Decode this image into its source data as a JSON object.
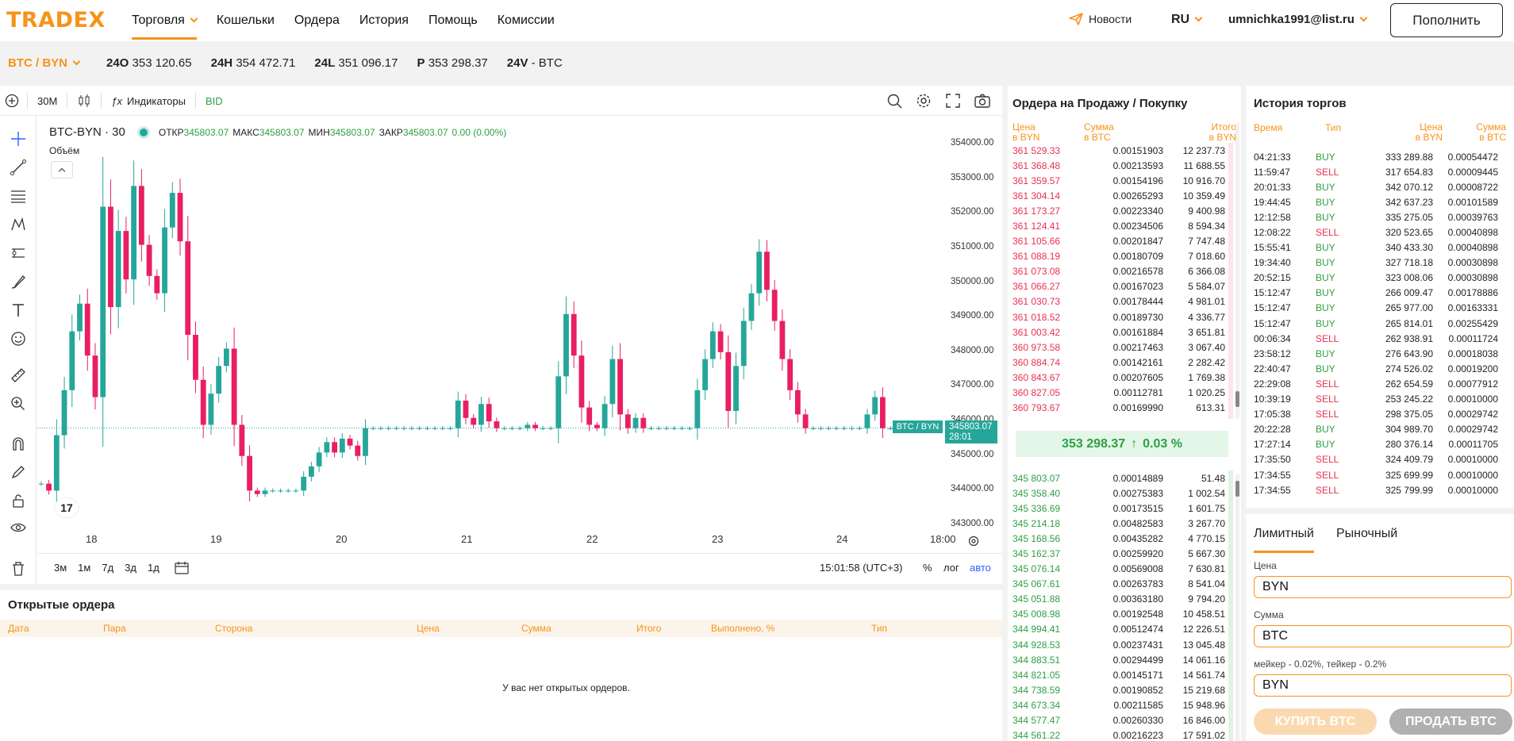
{
  "header": {
    "logo": "TRADEX",
    "nav": [
      {
        "label": "Торговля",
        "active": true
      },
      {
        "label": "Кошельки"
      },
      {
        "label": "Ордера"
      },
      {
        "label": "История"
      },
      {
        "label": "Помощь"
      },
      {
        "label": "Комиссии"
      }
    ],
    "news": "Новости",
    "lang": "RU",
    "user": "umnichka1991@list.ru",
    "deposit": "Пополнить"
  },
  "ticker": {
    "pair": "BTC / BYN",
    "stats": [
      {
        "k": "24O",
        "v": "353 120.65"
      },
      {
        "k": "24H",
        "v": "354 472.71"
      },
      {
        "k": "24L",
        "v": "351 096.17"
      },
      {
        "k": "P",
        "v": "353 298.37"
      },
      {
        "k": "24V",
        "v": "- BTC"
      }
    ]
  },
  "chart": {
    "interval": "30M",
    "indicators": "Индикаторы",
    "bid": "BID",
    "symbol": "BTC-BYN · 30",
    "ohlc": [
      {
        "k": "ОТКР",
        "v": "345803.07"
      },
      {
        "k": "МАКС",
        "v": "345803.07"
      },
      {
        "k": "МИН",
        "v": "345803.07"
      },
      {
        "k": "ЗАКР",
        "v": "345803.07"
      }
    ],
    "change": "0.00 (0.00%)",
    "volume_label": "Объём",
    "price_tag_symbol": "BTC / BYN",
    "price_tag_price": "345803.07",
    "price_tag_time": "28:01",
    "ranges": [
      "3м",
      "1м",
      "7д",
      "3д",
      "1д"
    ],
    "clock": "15:01:58 (UTC+3)",
    "pct": "%",
    "log": "лог",
    "auto": "авто",
    "colors": {
      "up": "#26a69a",
      "down": "#e91e63"
    }
  },
  "chart_data": {
    "type": "candlestick",
    "x_ticks": [
      "18",
      "19",
      "20",
      "21",
      "22",
      "23",
      "24",
      "18:00"
    ],
    "y_ticks": [
      "354000.00",
      "353000.00",
      "352000.00",
      "351000.00",
      "350000.00",
      "349000.00",
      "348000.00",
      "347000.00",
      "346000.00",
      "345000.00",
      "344000.00",
      "343000.00"
    ],
    "ylim": [
      343000,
      354000
    ],
    "last_price": 345803.07,
    "closes": [
      344200,
      344000,
      345600,
      346900,
      348600,
      349400,
      347900,
      346700,
      352200,
      349300,
      351500,
      350100,
      352800,
      351100,
      350200,
      349700,
      351600,
      352600,
      351200,
      348500,
      347200,
      345900,
      346800,
      347600,
      348100,
      345900,
      345000,
      344000,
      343900,
      344000,
      344000,
      344000,
      344000,
      344000,
      344400,
      344700,
      345100,
      345400,
      345100,
      345500,
      345300,
      345000,
      345800,
      345803,
      345803,
      345803,
      345803,
      345803,
      345803,
      345803,
      345803,
      345803,
      345803,
      345803,
      346600,
      346100,
      345900,
      346500,
      346000,
      345803,
      345803,
      345803,
      345803,
      345900,
      345803,
      345803,
      345803,
      347300,
      349100,
      347900,
      346400,
      345900,
      345803,
      346500,
      347800,
      346200,
      345803,
      346100,
      345803,
      345803,
      345803,
      345803,
      345803,
      345803,
      345803,
      346900,
      347800,
      348600,
      348000,
      346300,
      347600,
      348900,
      349700,
      350900,
      349800,
      348900,
      347800,
      346900,
      346200,
      345803,
      345803,
      345803,
      345803,
      345803,
      345803,
      345803,
      345803,
      346200,
      346700,
      345803,
      345803
    ]
  },
  "orderbook": {
    "title": "Ордера на Продажу / Покупку",
    "cols": [
      "Цена",
      "в BYN",
      "Сумма",
      "в BTC",
      "Итого",
      "в BYN"
    ],
    "asks": [
      [
        "361 529.33",
        "0.00151903",
        "12 237.73"
      ],
      [
        "361 368.48",
        "0.00213593",
        "11 688.55"
      ],
      [
        "361 359.57",
        "0.00154196",
        "10 916.70"
      ],
      [
        "361 304.14",
        "0.00265293",
        "10 359.49"
      ],
      [
        "361 173.27",
        "0.00223340",
        "9 400.98"
      ],
      [
        "361 124.41",
        "0.00234506",
        "8 594.34"
      ],
      [
        "361 105.66",
        "0.00201847",
        "7 747.48"
      ],
      [
        "361 088.19",
        "0.00180709",
        "7 018.60"
      ],
      [
        "361 073.08",
        "0.00216578",
        "6 366.08"
      ],
      [
        "361 066.27",
        "0.00167023",
        "5 584.07"
      ],
      [
        "361 030.73",
        "0.00178444",
        "4 981.01"
      ],
      [
        "361 018.52",
        "0.00189730",
        "4 336.77"
      ],
      [
        "361 003.42",
        "0.00161884",
        "3 651.81"
      ],
      [
        "360 973.58",
        "0.00217463",
        "3 067.40"
      ],
      [
        "360 884.74",
        "0.00142161",
        "2 282.42"
      ],
      [
        "360 843.67",
        "0.00207605",
        "1 769.38"
      ],
      [
        "360 827.05",
        "0.00112781",
        "1 020.25"
      ],
      [
        "360 793.67",
        "0.00169990",
        "613.31"
      ]
    ],
    "last_price": "353 298.37",
    "arrow": "↑",
    "last_change": "0.03 %",
    "bids": [
      [
        "345 803.07",
        "0.00014889",
        "51.48"
      ],
      [
        "345 358.40",
        "0.00275383",
        "1 002.54"
      ],
      [
        "345 336.69",
        "0.00173515",
        "1 601.75"
      ],
      [
        "345 214.18",
        "0.00482583",
        "3 267.70"
      ],
      [
        "345 168.56",
        "0.00435282",
        "4 770.15"
      ],
      [
        "345 162.37",
        "0.00259920",
        "5 667.30"
      ],
      [
        "345 076.14",
        "0.00569008",
        "7 630.81"
      ],
      [
        "345 067.61",
        "0.00263783",
        "8 541.04"
      ],
      [
        "345 051.88",
        "0.00363180",
        "9 794.20"
      ],
      [
        "345 008.98",
        "0.00192548",
        "10 458.51"
      ],
      [
        "344 994.41",
        "0.00512474",
        "12 226.51"
      ],
      [
        "344 928.53",
        "0.00237431",
        "13 045.48"
      ],
      [
        "344 883.51",
        "0.00294499",
        "14 061.16"
      ],
      [
        "344 821.05",
        "0.00145171",
        "14 561.74"
      ],
      [
        "344 738.59",
        "0.00190852",
        "15 219.68"
      ],
      [
        "344 673.34",
        "0.00211585",
        "15 948.96"
      ],
      [
        "344 577.47",
        "0.00260330",
        "16 846.00"
      ],
      [
        "344 561.22",
        "0.00216223",
        "17 591.02"
      ]
    ]
  },
  "history": {
    "title": "История торгов",
    "cols": [
      "Время",
      "Тип",
      "Цена",
      "в BYN",
      "Сумма",
      "в BTC"
    ],
    "rows": [
      [
        "04:21:33",
        "BUY",
        "333 289.88",
        "0.00054472"
      ],
      [
        "11:59:47",
        "SELL",
        "317 654.83",
        "0.00009445"
      ],
      [
        "20:01:33",
        "BUY",
        "342 070.12",
        "0.00008722"
      ],
      [
        "19:44:45",
        "BUY",
        "342 637.23",
        "0.00101589"
      ],
      [
        "12:12:58",
        "BUY",
        "335 275.05",
        "0.00039763"
      ],
      [
        "12:08:22",
        "SELL",
        "320 523.65",
        "0.00040898"
      ],
      [
        "15:55:41",
        "BUY",
        "340 433.30",
        "0.00040898"
      ],
      [
        "19:34:40",
        "BUY",
        "327 718.18",
        "0.00030898"
      ],
      [
        "20:52:15",
        "BUY",
        "323 008.06",
        "0.00030898"
      ],
      [
        "15:12:47",
        "BUY",
        "266 009.47",
        "0.00178886"
      ],
      [
        "15:12:47",
        "BUY",
        "265 977.00",
        "0.00163331"
      ],
      [
        "15:12:47",
        "BUY",
        "265 814.01",
        "0.00255429"
      ],
      [
        "00:06:34",
        "SELL",
        "262 938.91",
        "0.00011724"
      ],
      [
        "23:58:12",
        "BUY",
        "276 643.90",
        "0.00018038"
      ],
      [
        "22:40:47",
        "BUY",
        "274 526.02",
        "0.00019200"
      ],
      [
        "22:29:08",
        "SELL",
        "262 654.59",
        "0.00077912"
      ],
      [
        "10:39:19",
        "SELL",
        "253 245.22",
        "0.00010000"
      ],
      [
        "17:05:38",
        "SELL",
        "298 375.05",
        "0.00029742"
      ],
      [
        "20:22:28",
        "BUY",
        "304 989.70",
        "0.00029742"
      ],
      [
        "17:27:14",
        "BUY",
        "280 376.14",
        "0.00011705"
      ],
      [
        "17:35:50",
        "SELL",
        "324 409.79",
        "0.00010000"
      ],
      [
        "17:34:55",
        "SELL",
        "325 699.99",
        "0.00010000"
      ],
      [
        "17:34:55",
        "SELL",
        "325 799.99",
        "0.00010000"
      ]
    ]
  },
  "form": {
    "tabs": [
      "Лимитный",
      "Рыночный"
    ],
    "price_label": "Цена",
    "price_unit": "BYN",
    "amount_label": "Сумма",
    "amount_unit": "BTC",
    "fee_label": "мейкер - 0.02%, тейкер - 0.2%",
    "total_unit": "BYN",
    "buy": "КУПИТЬ BTC",
    "sell": "ПРОДАТЬ BTC"
  },
  "open_orders": {
    "title": "Открытые ордера",
    "cols": [
      "Дата",
      "Пара",
      "Сторона",
      "Цена",
      "Сумма",
      "Итого",
      "Выполнено, %",
      "Тип"
    ],
    "empty": "У вас нет открытых ордеров."
  }
}
